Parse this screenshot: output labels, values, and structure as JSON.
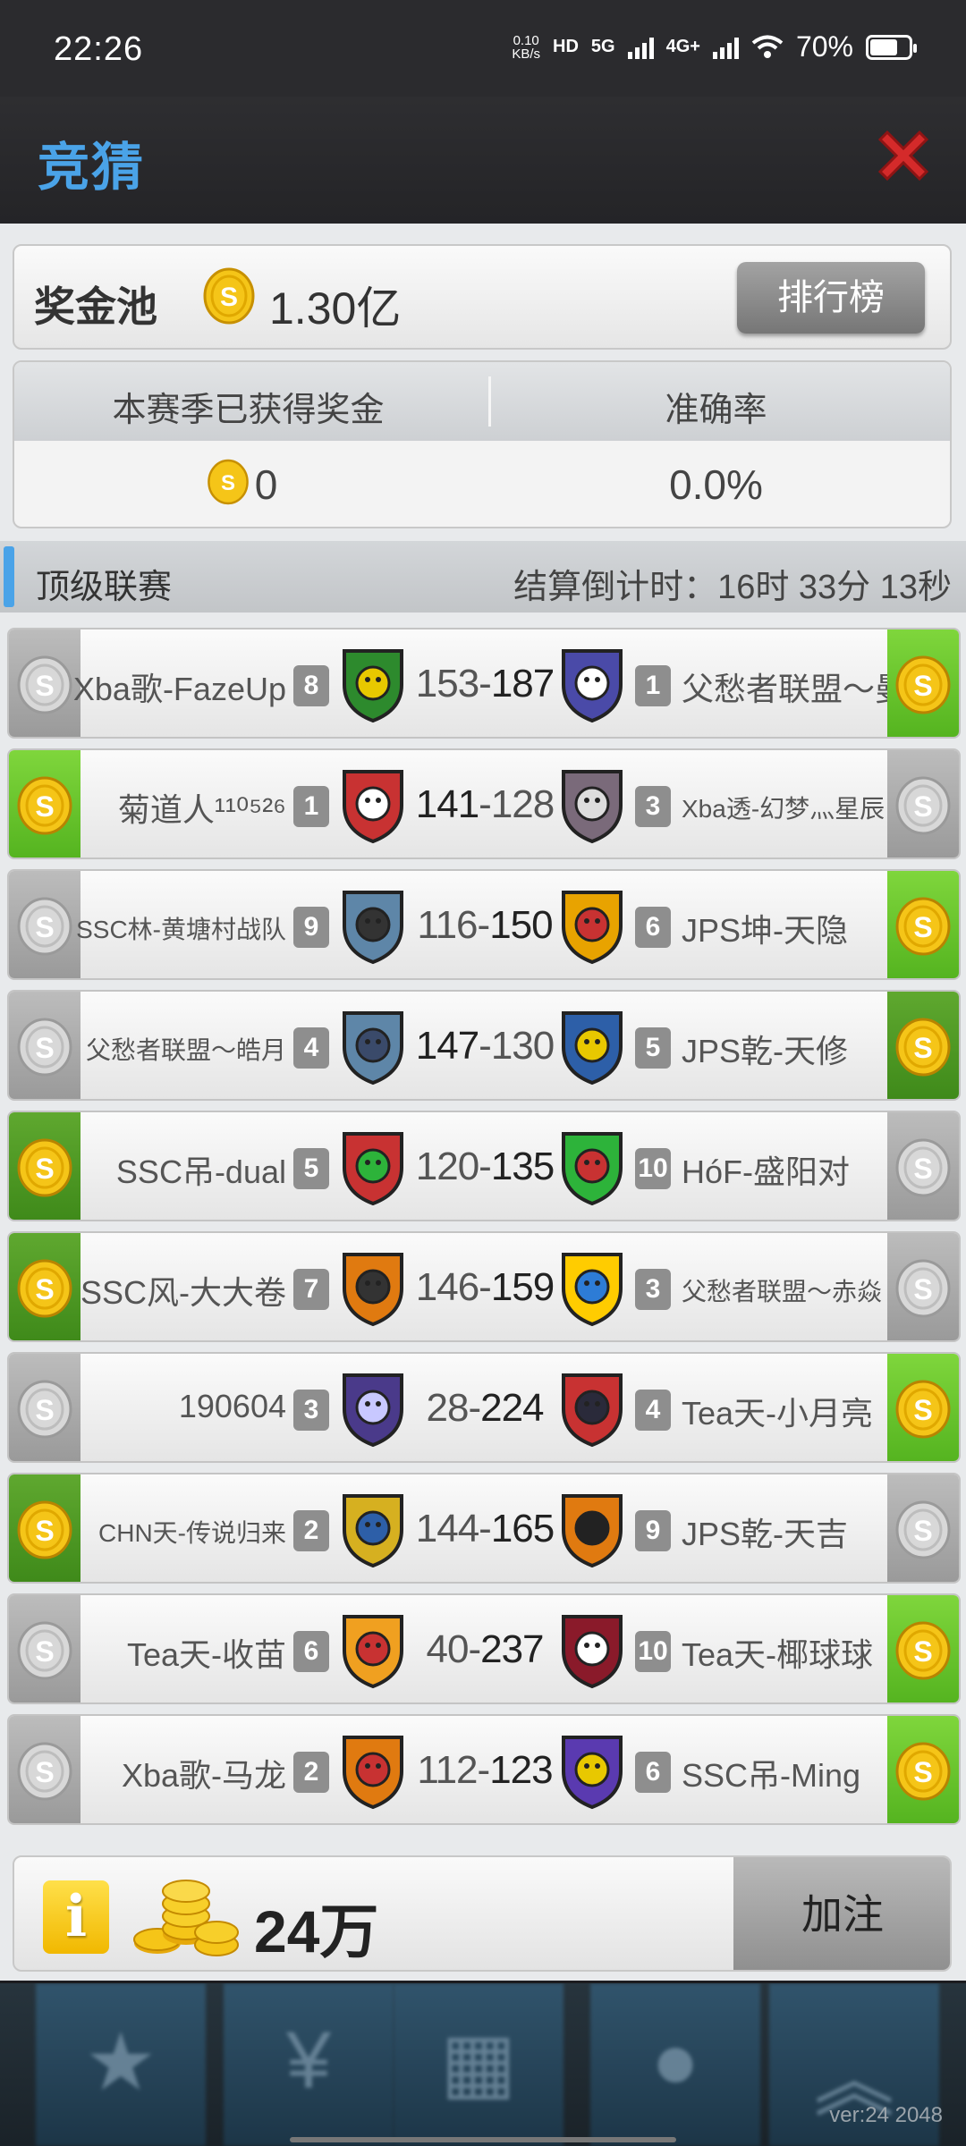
{
  "status_bar": {
    "time": "22:26",
    "net_speed_top": "0.10",
    "net_speed_bottom": "KB/s",
    "hd_tag": "HD",
    "net1": "5G",
    "net2": "4G+",
    "battery": "70%"
  },
  "header": {
    "title": "竞猜"
  },
  "pool": {
    "label": "奖金池",
    "amount": "1.30亿",
    "rank_button": "排行榜"
  },
  "stats": {
    "earned_label": "本赛季已获得奖金",
    "accuracy_label": "准确率",
    "earned_value": "0",
    "accuracy_value": "0.0%"
  },
  "league": {
    "name": "顶级联赛",
    "countdown": "结算倒计时：16时 33分 13秒"
  },
  "matches": [
    {
      "left_name": "Xba歌-FazeUp",
      "left_rank": "8",
      "left_score": "153",
      "right_score": "187",
      "right_rank": "1",
      "right_name": "父愁者联盟～曼非矢"
    },
    {
      "left_name": "菊道人¹¹⁰⁵²⁶",
      "left_rank": "1",
      "left_score": "141",
      "right_score": "128",
      "right_rank": "3",
      "right_name": "Xba透-幻梦灬星辰"
    },
    {
      "left_name": "SSC林-黄塘村战队",
      "left_rank": "9",
      "left_score": "116",
      "right_score": "150",
      "right_rank": "6",
      "right_name": "JPS坤-天隐"
    },
    {
      "left_name": "父愁者联盟～皓月",
      "left_rank": "4",
      "left_score": "147",
      "right_score": "130",
      "right_rank": "5",
      "right_name": "JPS乾-天修"
    },
    {
      "left_name": "SSC吊-dual",
      "left_rank": "5",
      "left_score": "120",
      "right_score": "135",
      "right_rank": "10",
      "right_name": "HóF-盛阳对"
    },
    {
      "left_name": "SSC风-大大卷",
      "left_rank": "7",
      "left_score": "146",
      "right_score": "159",
      "right_rank": "3",
      "right_name": "父愁者联盟～赤焱"
    },
    {
      "left_name": "190604",
      "left_rank": "3",
      "left_score": "28",
      "right_score": "224",
      "right_rank": "4",
      "right_name": "Tea天-小月亮"
    },
    {
      "left_name": "CHN天-传说归来",
      "left_rank": "2",
      "left_score": "144",
      "right_score": "165",
      "right_rank": "9",
      "right_name": "JPS乾-天吉"
    },
    {
      "left_name": "Tea天-收苗",
      "left_rank": "6",
      "left_score": "40",
      "right_score": "237",
      "right_rank": "10",
      "right_name": "Tea天-椰球球"
    },
    {
      "left_name": "Xba歌-马龙",
      "left_rank": "2",
      "left_score": "112",
      "right_score": "123",
      "right_rank": "6",
      "right_name": "SSC吊-Ming"
    }
  ],
  "bet": {
    "info_icon": "i",
    "amount": "24万",
    "add_button": "加注"
  },
  "version": "ver:24  2048",
  "colors": {
    "accent_blue": "#4aa3e8",
    "win_green": "#66c22a",
    "close_red": "#d42a2a",
    "coin_gold": "#f5c518"
  }
}
